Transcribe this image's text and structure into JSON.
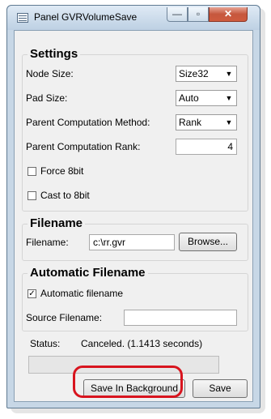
{
  "window": {
    "title": "Panel GVRVolumeSave",
    "minimize_glyph": "—",
    "maximize_glyph": "▫",
    "close_glyph": "✕"
  },
  "settings": {
    "title": "Settings",
    "node_size": {
      "label": "Node Size:",
      "value": "Size32"
    },
    "pad_size": {
      "label": "Pad Size:",
      "value": "Auto"
    },
    "parent_method": {
      "label": "Parent Computation Method:",
      "value": "Rank"
    },
    "parent_rank": {
      "label": "Parent Computation Rank:",
      "value": "4"
    },
    "force_8bit": {
      "label": "Force 8bit",
      "checked": false
    },
    "cast_8bit": {
      "label": "Cast to 8bit",
      "checked": false
    }
  },
  "filename": {
    "title": "Filename",
    "label": "Filename:",
    "value": "c:\\rr.gvr",
    "browse_label": "Browse..."
  },
  "auto_filename": {
    "title": "Automatic Filename",
    "checkbox_label": "Automatic filename",
    "checkbox_mark": "✓",
    "checked": true,
    "source_label": "Source Filename:",
    "source_value": ""
  },
  "status": {
    "label": "Status:",
    "text": "Canceled. (1.1413 seconds)"
  },
  "buttons": {
    "save_background": "Save In Background",
    "save": "Save"
  },
  "icons": {
    "dropdown_arrow": "▼"
  }
}
